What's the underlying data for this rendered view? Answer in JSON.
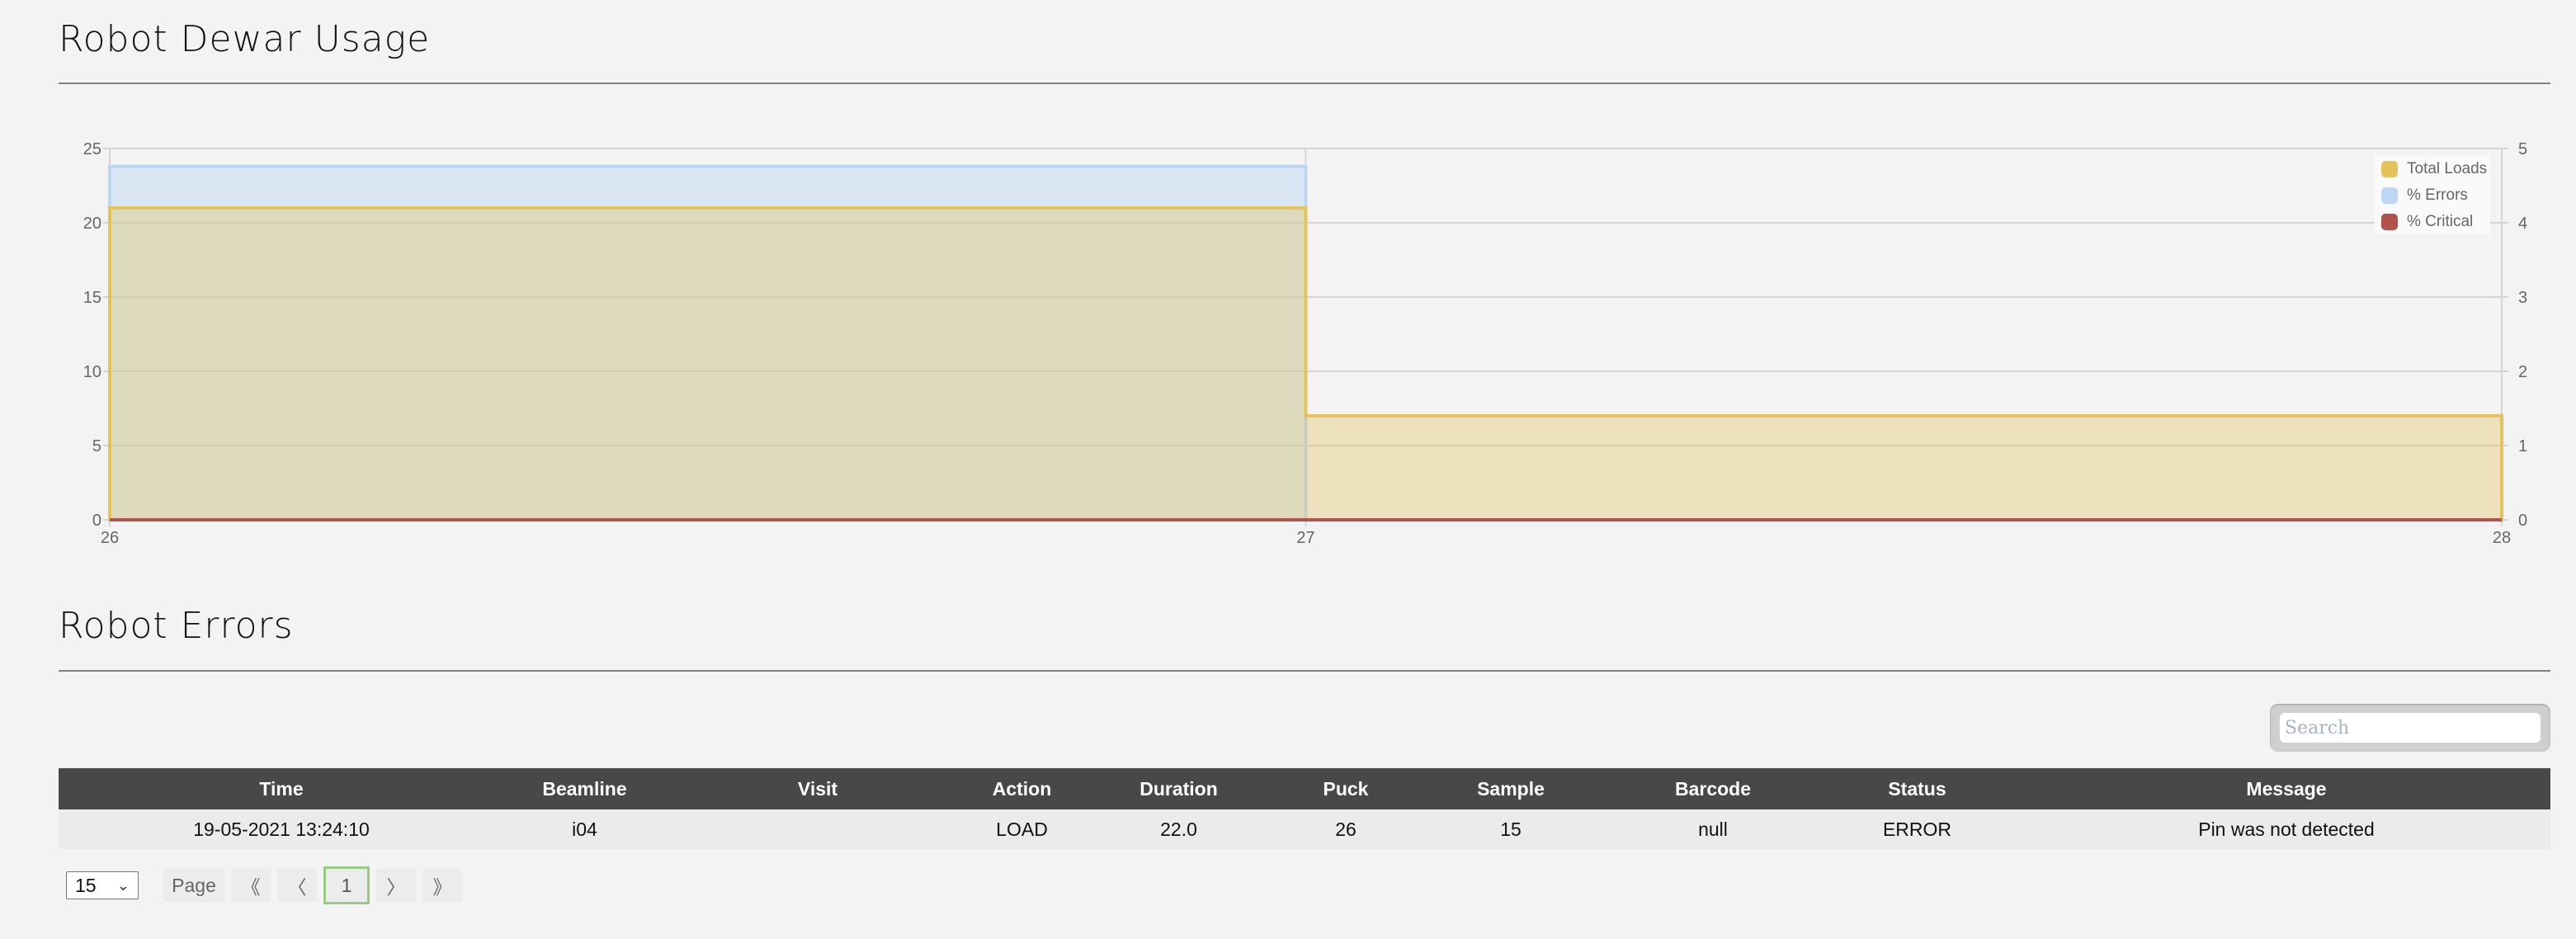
{
  "sections": {
    "usage_title": "Robot Dewar Usage",
    "errors_title": "Robot Errors"
  },
  "chart_data": {
    "type": "area",
    "step": true,
    "title": "",
    "xlabel": "",
    "ylabel": "",
    "x": [
      26,
      27,
      28
    ],
    "x_ticks": [
      "26",
      "27",
      "28"
    ],
    "x_range": [
      26,
      28
    ],
    "y_left": {
      "range": [
        0,
        25
      ],
      "ticks": [
        "0",
        "5",
        "10",
        "15",
        "20",
        "25"
      ]
    },
    "y_right": {
      "range": [
        0,
        5
      ],
      "ticks": [
        "0",
        "1",
        "2",
        "3",
        "4",
        "5"
      ]
    },
    "grid": true,
    "legend_position": "top-right",
    "series": [
      {
        "name": "Total Loads",
        "axis": "left",
        "color": "#e3c35a",
        "fill": "rgba(227,195,90,0.35)",
        "values": [
          21,
          7,
          7
        ]
      },
      {
        "name": "% Errors",
        "axis": "right",
        "color": "#bcd6f3",
        "fill": "rgba(188,214,243,0.45)",
        "values": [
          4.76,
          0,
          0
        ]
      },
      {
        "name": "% Critical",
        "axis": "right",
        "color": "#b0534b",
        "fill": "rgba(176,83,75,0.4)",
        "values": [
          0,
          0,
          0
        ]
      }
    ]
  },
  "search": {
    "placeholder": "Search",
    "value": ""
  },
  "table": {
    "columns": [
      "Time",
      "Beamline",
      "Visit",
      "Action",
      "Duration",
      "Puck",
      "Sample",
      "Barcode",
      "Status",
      "Message"
    ],
    "rows": [
      [
        "19-05-2021 13:24:10",
        "i04",
        "",
        "LOAD",
        "22.0",
        "26",
        "15",
        "null",
        "ERROR",
        "Pin was not detected"
      ]
    ]
  },
  "pagination": {
    "page_size": "15",
    "page_label": "Page",
    "first_label": "《",
    "prev_label": "〈",
    "current_page": "1",
    "next_label": "〉",
    "last_label": "》"
  },
  "colors": {
    "header_bg": "#484848",
    "row_bg": "#ebebeb",
    "current_page_border": "#98cb84"
  }
}
